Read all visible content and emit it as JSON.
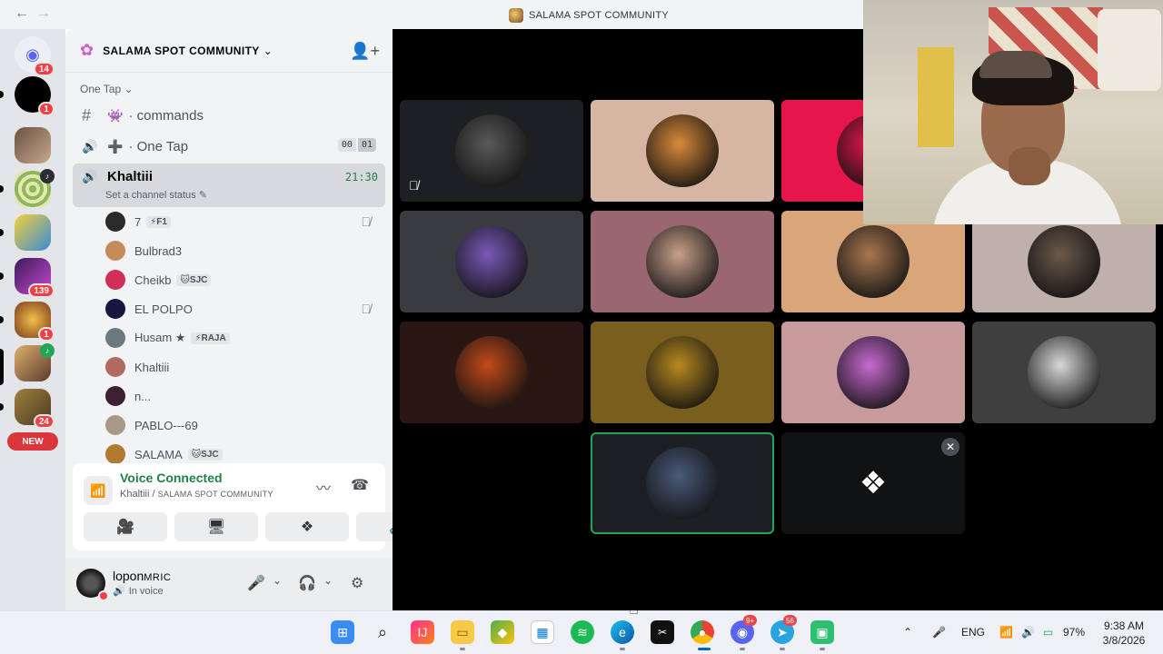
{
  "titlebar": {
    "back": "←",
    "forward": "→",
    "title": "SALAMA SPOT COMMUNITY"
  },
  "rail": {
    "dm_badge": "14",
    "servers": [
      {
        "badge": "1"
      },
      {
        "badge": ""
      },
      {
        "badge": ""
      },
      {
        "badge": ""
      },
      {
        "badge": "139"
      },
      {
        "badge": "1"
      },
      {
        "badge": ""
      },
      {
        "badge": "24"
      }
    ],
    "new_label": "NEW"
  },
  "sidebar": {
    "server_name": "SALAMA SPOT COMMUNITY",
    "category": "One Tap",
    "channels": [
      {
        "icon": "#",
        "emoji": "👾",
        "name": "commands"
      },
      {
        "icon": "🔊",
        "emoji": "➕",
        "name": "One Tap",
        "count_a": "00",
        "count_b": "01"
      }
    ],
    "active_channel": {
      "name": "Khaltiii",
      "timer": "21:30",
      "status_hint": "Set a channel status ✎"
    },
    "members": [
      {
        "name": "7",
        "tag": "⚡F1",
        "muted": true,
        "color": "#2a2a2a"
      },
      {
        "name": "Bulbrad3",
        "tag": "",
        "muted": false,
        "color": "#c48a5a"
      },
      {
        "name": "Cheikb",
        "tag": "🐱SJC",
        "muted": false,
        "color": "#d12f5a"
      },
      {
        "name": "EL POLPO",
        "tag": "",
        "muted": true,
        "color": "#1a1640"
      },
      {
        "name": "Husam ★",
        "tag": "⚡RAJA",
        "muted": false,
        "color": "#6b7a80"
      },
      {
        "name": "Khaltiii",
        "tag": "",
        "muted": false,
        "color": "#b06a60"
      },
      {
        "name": "n...",
        "tag": "",
        "muted": false,
        "color": "#3a2030"
      },
      {
        "name": "PABLO---69",
        "tag": "",
        "muted": false,
        "color": "#a89888"
      },
      {
        "name": "SALAMA",
        "tag": "🐱SJC",
        "muted": false,
        "color": "#b07a30"
      }
    ]
  },
  "voice": {
    "title": "Voice Connected",
    "channel": "Khaltiii /",
    "server": "SALAMA SPOT COMMUNITY"
  },
  "user": {
    "name": "lopon",
    "name_suffix": "MRIC",
    "status": "In voice"
  },
  "stage": {
    "tiles": [
      {
        "bg": "#1e1f22",
        "av": "#5a5a5a",
        "muted": true
      },
      {
        "bg": "#d6b6a2",
        "av": "#d98a3a",
        "muted": false
      },
      {
        "bg": "#e6164c",
        "av": "#e6164c",
        "muted": false
      },
      {
        "bg": "#3a3b3f",
        "av": "#7a5ab8",
        "muted": false
      },
      {
        "bg": "#9a6670",
        "av": "#c9a08a",
        "muted": false
      },
      {
        "bg": "#d9a57a",
        "av": "#a87850",
        "muted": false
      },
      {
        "bg": "#bfb0ac",
        "av": "#6a5a4a",
        "muted": false
      },
      {
        "bg": "#2a1612",
        "av": "#c24a1a",
        "muted": false
      },
      {
        "bg": "#7a5e1e",
        "av": "#b88a20",
        "muted": false
      },
      {
        "bg": "#c79a9c",
        "av": "#c86ad0",
        "muted": false
      },
      {
        "bg": "#3f3f3f",
        "av": "#d8d8d8",
        "muted": false
      },
      {
        "bg": "#1e1f22",
        "av": "#4a5a7a",
        "muted": false
      }
    ],
    "activity_glyph": "❖",
    "close": "✕"
  },
  "taskbar": {
    "lang": "ENG",
    "battery": "97%",
    "time": "9:38 AM",
    "date": "3/8/2026",
    "discord_badge": "9+",
    "telegram_badge": "56"
  }
}
